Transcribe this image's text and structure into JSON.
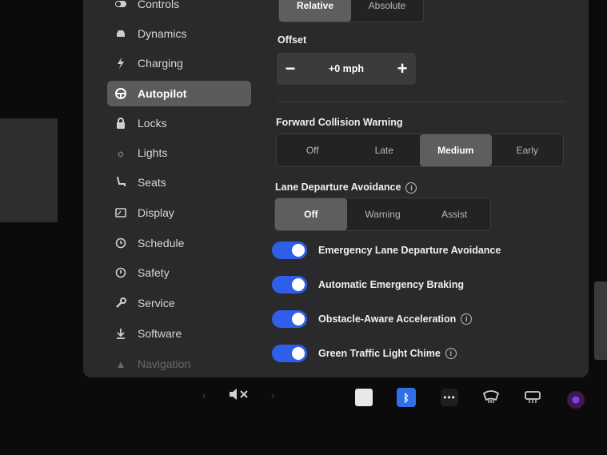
{
  "sidebar": {
    "items": [
      {
        "label": "Controls",
        "icon": "toggle-icon"
      },
      {
        "label": "Dynamics",
        "icon": "car-icon"
      },
      {
        "label": "Charging",
        "icon": "bolt-icon"
      },
      {
        "label": "Autopilot",
        "icon": "steering-wheel-icon",
        "active": true
      },
      {
        "label": "Locks",
        "icon": "lock-icon"
      },
      {
        "label": "Lights",
        "icon": "sun-icon"
      },
      {
        "label": "Seats",
        "icon": "seat-icon"
      },
      {
        "label": "Display",
        "icon": "display-icon"
      },
      {
        "label": "Schedule",
        "icon": "clock-icon"
      },
      {
        "label": "Safety",
        "icon": "safety-icon"
      },
      {
        "label": "Service",
        "icon": "wrench-icon"
      },
      {
        "label": "Software",
        "icon": "download-icon"
      },
      {
        "label": "Navigation",
        "icon": "navigation-icon"
      }
    ]
  },
  "speed_mode": {
    "options": [
      "Relative",
      "Absolute"
    ],
    "selected": "Relative"
  },
  "offset": {
    "label": "Offset",
    "value": "+0 mph",
    "minus": "−",
    "plus": "+"
  },
  "fcw": {
    "label": "Forward Collision Warning",
    "options": [
      "Off",
      "Late",
      "Medium",
      "Early"
    ],
    "selected": "Medium"
  },
  "lda": {
    "label": "Lane Departure Avoidance",
    "options": [
      "Off",
      "Warning",
      "Assist"
    ],
    "selected": "Off"
  },
  "toggles": [
    {
      "label": "Emergency Lane Departure Avoidance",
      "on": true,
      "info": false
    },
    {
      "label": "Automatic Emergency Braking",
      "on": true,
      "info": false
    },
    {
      "label": "Obstacle-Aware Acceleration",
      "on": true,
      "info": true
    },
    {
      "label": "Green Traffic Light Chime",
      "on": true,
      "info": true
    }
  ],
  "taskbar": {
    "icons": [
      "chevron-left-icon",
      "mute-icon",
      "chevron-right-icon",
      "notes-icon",
      "bluetooth-icon",
      "more-icon",
      "front-defrost-icon",
      "rear-defrost-icon",
      "camera-icon"
    ],
    "bluetooth_glyph": "ᛒ",
    "more_glyph": "•••"
  },
  "colors": {
    "toggle_on": "#2f5fe8",
    "selected_segment": "#5e5e61",
    "bluetooth": "#2f6fe8"
  }
}
